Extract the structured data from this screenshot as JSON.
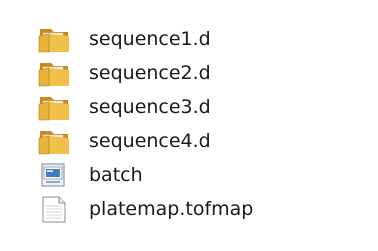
{
  "files": [
    {
      "name": "sequence1.d",
      "icon": "folder-icon"
    },
    {
      "name": "sequence2.d",
      "icon": "folder-icon"
    },
    {
      "name": "sequence3.d",
      "icon": "folder-icon"
    },
    {
      "name": "sequence4.d",
      "icon": "folder-icon"
    },
    {
      "name": "batch",
      "icon": "batch-file-icon"
    },
    {
      "name": "platemap.tofmap",
      "icon": "document-icon"
    }
  ],
  "colors": {
    "folder_front": "#e8b33a",
    "folder_back": "#c98a1c",
    "folder_paper": "#f6f2e4",
    "text": "#1a1a1a"
  }
}
